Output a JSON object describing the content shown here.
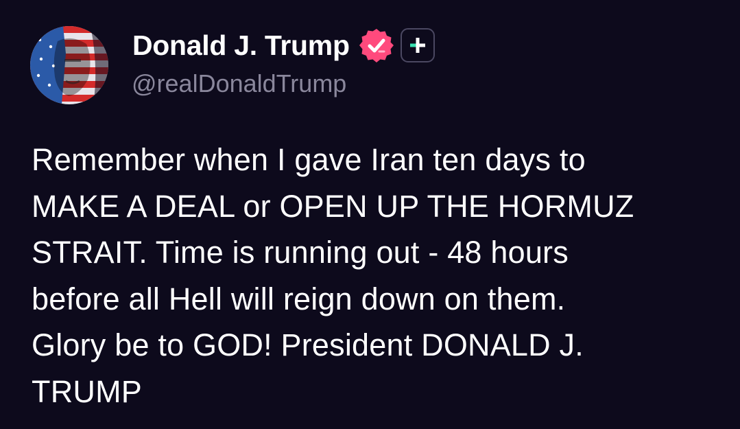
{
  "post": {
    "author": {
      "display_name": "Donald J. Trump",
      "handle": "@realDonaldTrump",
      "verified": true,
      "avatar_icon": "flag-portrait-avatar",
      "badge_icon": "verified-badge-icon",
      "badge_color": "#ff4a7d",
      "follow_icon": "plus-icon",
      "follow_accent": "#38e0b0"
    },
    "text_lines": [
      "Remember when I gave Iran ten days to",
      "MAKE A DEAL or OPEN UP THE HORMUZ",
      "STRAIT. Time is running out - 48 hours",
      "before all Hell will reign down on them.",
      "Glory be to GOD! President DONALD J.",
      "TRUMP"
    ]
  },
  "colors": {
    "background": "#0d0a1c",
    "text": "#ffffff",
    "handle": "#8a879c"
  }
}
